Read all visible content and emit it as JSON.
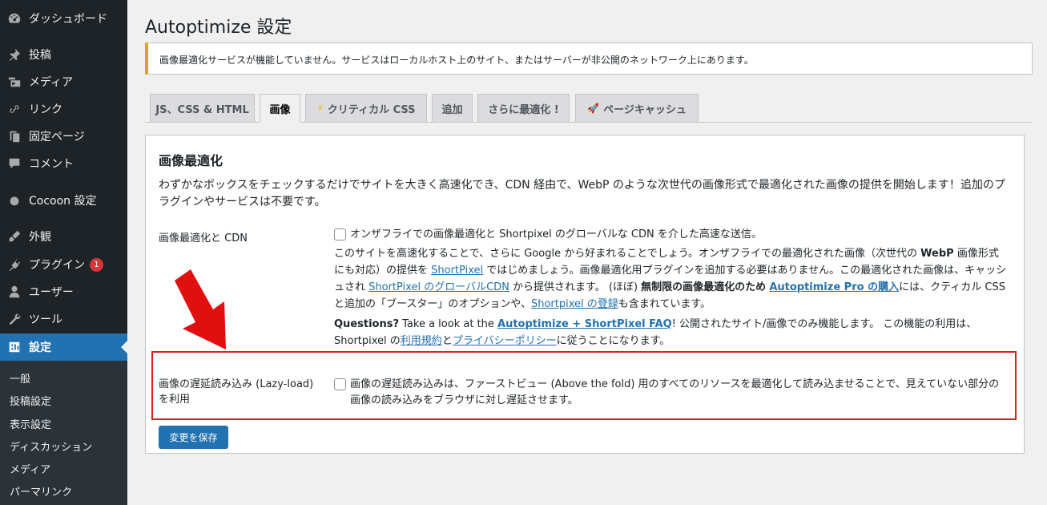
{
  "sidebar": {
    "items": [
      {
        "label": "ダッシュボード",
        "icon": "dashboard-icon"
      },
      {
        "label": "投稿",
        "icon": "pin-icon"
      },
      {
        "label": "メディア",
        "icon": "media-icon"
      },
      {
        "label": "リンク",
        "icon": "link-icon"
      },
      {
        "label": "固定ページ",
        "icon": "page-icon"
      },
      {
        "label": "コメント",
        "icon": "comment-icon"
      },
      {
        "label": "Cocoon 設定",
        "icon": "circle-icon"
      },
      {
        "label": "外観",
        "icon": "brush-icon"
      },
      {
        "label": "プラグイン",
        "icon": "plugin-icon",
        "badge": "1"
      },
      {
        "label": "ユーザー",
        "icon": "user-icon"
      },
      {
        "label": "ツール",
        "icon": "wrench-icon"
      },
      {
        "label": "設定",
        "icon": "settings-icon"
      }
    ],
    "submenu": [
      "一般",
      "投稿設定",
      "表示設定",
      "ディスカッション",
      "メディア",
      "パーマリンク"
    ]
  },
  "page": {
    "title": "Autoptimize 設定",
    "notice": "画像最適化サービスが機能していません。サービスはローカルホスト上のサイト、またはサーバーが非公開のネットワーク上にあります。"
  },
  "tabs": [
    {
      "label": "JS、CSS & HTML",
      "icon": ""
    },
    {
      "label": "画像",
      "icon": ""
    },
    {
      "label": "クリティカル CSS",
      "icon": "⚡"
    },
    {
      "label": "追加",
      "icon": ""
    },
    {
      "label": "さらに最適化 !",
      "icon": ""
    },
    {
      "label": "ページキャッシュ",
      "icon": "🚀"
    }
  ],
  "panel": {
    "title": "画像最適化",
    "intro": "わずかなボックスをチェックするだけでサイトを大きく高速化でき、CDN 経由で、WebP のような次世代の画像形式で最適化された画像の提供を開始します！追加のプラグインやサービスは不要です。",
    "cdn": {
      "label": "画像最適化と CDN",
      "checkbox": "オンザフライでの画像最適化と Shortpixel のグローバルな CDN を介した高速な送信。",
      "d1": "このサイトを高速化することで、さらに Google から好まれることでしょう。オンザフライでの最適化された画像（次世代の ",
      "d1b": "WebP",
      "d2": " 画像形式にも対応）の提供を ",
      "link1": "ShortPixel",
      "d3": " ではじめましょう。画像最適化用プラグインを追加する必要はありません。この最適化された画像は、キャッシュされ ",
      "link2": "ShortPixel のグローバルCDN",
      "d4": " から提供されます。 (ほぼ) ",
      "d4b": "無制限の画像最適化のため",
      "d5": " ",
      "link3": "Autoptimize Pro の購入",
      "d6": "には、クティカル CSS と追加の「ブースター」のオプションや、",
      "link4": "Shortpixel の登録",
      "d7": "も含まれています。",
      "q1": "Questions?",
      "q2": " Take a look at the ",
      "link5": "Autoptimize + ShortPixel FAQ",
      "q3": "! 公開されたサイト/画像でのみ機能します。 この機能の利用は、Shortpixel の",
      "link6": "利用規約",
      "q4": "と",
      "link7": "プライバシーポリシー",
      "q5": "に従うことになります。"
    },
    "lazy": {
      "label1": "画像の遅延読み込み (Lazy-load)",
      "label2": "を利用",
      "checkbox": "画像の遅延読み込みは、ファーストビュー (Above the fold) 用のすべてのリソースを最適化して読み込ませることで、見えていない部分の画像の読み込みをブラウザに対し遅延させます。"
    },
    "save": "変更を保存"
  },
  "colors": {
    "accent": "#2271b1",
    "sidebar": "#1d2327",
    "warning": "#dba617",
    "highlight": "#e02020"
  }
}
